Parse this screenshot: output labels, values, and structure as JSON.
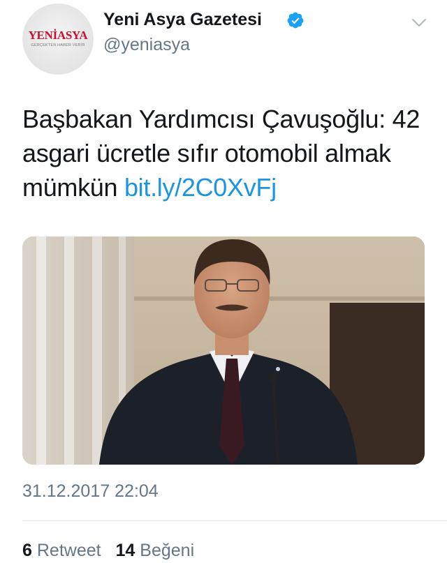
{
  "author": {
    "display_name": "Yeni Asya Gazetesi",
    "handle": "@yeniasya",
    "verified": true,
    "avatar_icon": "yeni-asya-logo",
    "avatar_brand": "YENİASYA",
    "avatar_tagline": "GERÇEKTEN HABER VERİR"
  },
  "tweet": {
    "text": "Başbakan Yardımcısı Çavuşoğlu: 42 asgari ücretle sıfır otomobil almak mümkün",
    "link": "bit.ly/2C0XvFj",
    "timestamp": "31.12.2017 22:04"
  },
  "stats": {
    "retweets": "6",
    "retweets_label": "Retweet",
    "likes": "14",
    "likes_label": "Beğeni"
  },
  "colors": {
    "link": "#1b95e0",
    "verified": "#1da1f2",
    "muted": "#657786",
    "text": "#14171a",
    "brand": "#c8102e"
  }
}
